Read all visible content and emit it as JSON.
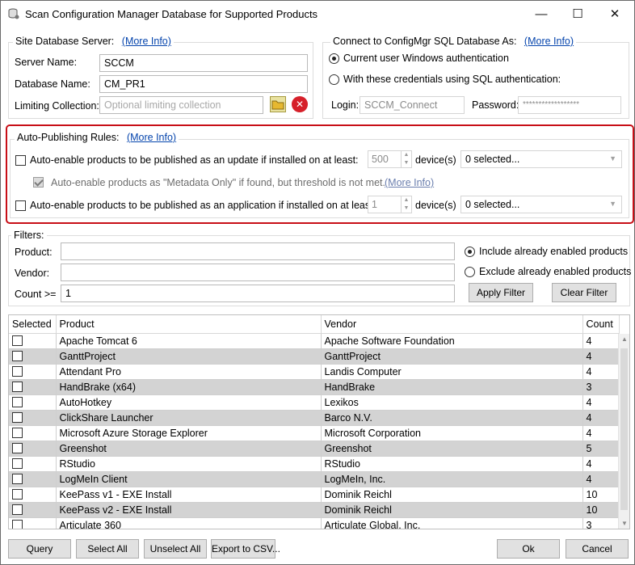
{
  "window": {
    "title": "Scan Configuration Manager Database for Supported Products",
    "minimize": "—",
    "maximize": "☐",
    "close": "✕"
  },
  "site_db": {
    "legend": "Site Database Server:",
    "more_info": "(More Info)",
    "server_label": "Server Name:",
    "server_value": "SCCM",
    "db_label": "Database Name:",
    "db_value": "CM_PR1",
    "collection_label": "Limiting Collection:",
    "collection_placeholder": "Optional limiting collection"
  },
  "connect": {
    "legend": "Connect to ConfigMgr SQL Database As:",
    "more_info": "(More Info)",
    "opt_windows": "Current user Windows authentication",
    "opt_sql": "With these credentials using SQL authentication:",
    "login_label": "Login:",
    "login_value": "SCCM_Connect",
    "password_label": "Password:",
    "password_value": "******************"
  },
  "auto": {
    "legend": "Auto-Publishing Rules:",
    "more_info": "(More Info)",
    "update_label": "Auto-enable products to be published as an update if installed on at least:",
    "update_count": "500",
    "update_units": "device(s)",
    "update_combo": "0 selected...",
    "metadata_label": "Auto-enable products as \"Metadata Only\" if found, but threshold is not met.",
    "metadata_more_info": "(More Info)",
    "app_label": "Auto-enable products to be published as an application if installed on at least:",
    "app_count": "1",
    "app_units": "device(s)",
    "app_combo": "0 selected..."
  },
  "filters": {
    "legend": "Filters:",
    "product_label": "Product:",
    "product_value": "",
    "vendor_label": "Vendor:",
    "vendor_value": "",
    "count_label": "Count >=",
    "count_value": "1",
    "include_label": "Include already enabled products",
    "exclude_label": "Exclude already enabled products",
    "apply_btn": "Apply Filter",
    "clear_btn": "Clear Filter"
  },
  "grid": {
    "columns": [
      "Selected",
      "Product",
      "Vendor",
      "Count"
    ],
    "rows": [
      {
        "product": "Apache Tomcat 6",
        "vendor": "Apache Software Foundation",
        "count": "4"
      },
      {
        "product": "GanttProject",
        "vendor": "GanttProject",
        "count": "4"
      },
      {
        "product": "Attendant Pro",
        "vendor": "Landis Computer",
        "count": "4"
      },
      {
        "product": "HandBrake (x64)",
        "vendor": "HandBrake",
        "count": "3"
      },
      {
        "product": "AutoHotkey",
        "vendor": "Lexikos",
        "count": "4"
      },
      {
        "product": "ClickShare Launcher",
        "vendor": "Barco N.V.",
        "count": "4"
      },
      {
        "product": "Microsoft Azure Storage Explorer",
        "vendor": "Microsoft Corporation",
        "count": "4"
      },
      {
        "product": "Greenshot",
        "vendor": "Greenshot",
        "count": "5"
      },
      {
        "product": "RStudio",
        "vendor": "RStudio",
        "count": "4"
      },
      {
        "product": "LogMeIn Client",
        "vendor": "LogMeIn, Inc.",
        "count": "4"
      },
      {
        "product": "KeePass v1 - EXE Install",
        "vendor": "Dominik Reichl",
        "count": "10"
      },
      {
        "product": "KeePass v2 - EXE Install",
        "vendor": "Dominik Reichl",
        "count": "10"
      },
      {
        "product": "Articulate 360",
        "vendor": "Articulate Global, Inc.",
        "count": "3"
      }
    ]
  },
  "footer": {
    "query": "Query",
    "select_all": "Select All",
    "unselect_all": "Unselect All",
    "export": "Export to CSV...",
    "ok": "Ok",
    "cancel": "Cancel"
  },
  "colors": {
    "highlight_border": "#c80f17",
    "link": "#0645ad",
    "alt_row": "#d3d3d3"
  }
}
